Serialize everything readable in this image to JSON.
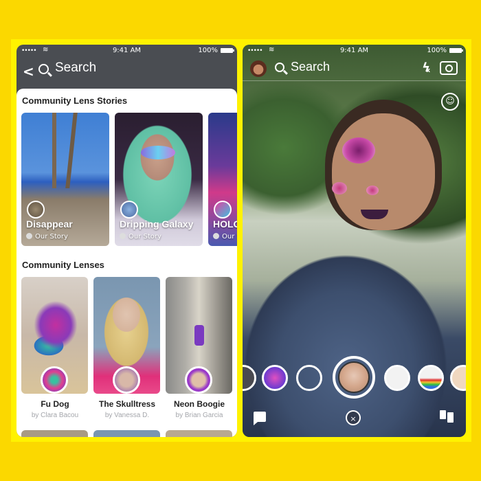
{
  "colors": {
    "outer_background": "#FBD800",
    "frame": "#FFF200",
    "header_dark": "#4A4D52",
    "subtext_gray": "#A4A6AB"
  },
  "left_phone": {
    "status_bar": {
      "signal": "•••••",
      "wifi": "wifi-icon",
      "time": "9:41 AM",
      "battery_pct": "100%"
    },
    "header": {
      "back_icon": "chevron-left-icon",
      "search_icon": "search-icon",
      "search_label": "Search"
    },
    "stories_section": {
      "title": "Community Lens Stories",
      "items": [
        {
          "name": "Disappear",
          "sub": "Our Story"
        },
        {
          "name": "Dripping Galaxy",
          "sub": "Our Story"
        },
        {
          "name": "HOLO",
          "sub": "Our Story"
        }
      ]
    },
    "lenses_section": {
      "title": "Community Lenses",
      "items": [
        {
          "name": "Fu Dog",
          "creator": "by Clara Bacou"
        },
        {
          "name": "The Skulltress",
          "creator": "by Vanessa D."
        },
        {
          "name": "Neon Boogie",
          "creator": "by Brian Garcia"
        }
      ]
    }
  },
  "right_phone": {
    "status_bar": {
      "signal": "•••••",
      "wifi": "wifi-icon",
      "time": "9:41 AM",
      "battery_pct": "100%"
    },
    "header": {
      "search_label": "Search",
      "flash_icon": "ϟ",
      "flash_off_mark": "x",
      "lens_explorer_icon": "☺"
    },
    "carousel": {
      "lenses": [
        "partial-lens",
        "dancer-lens",
        "empty-lens",
        "skulltress-lens-selected",
        "panda-lens",
        "rainbow-lens",
        "fox-lens"
      ],
      "selected_index": 3
    },
    "close_label": "×"
  }
}
